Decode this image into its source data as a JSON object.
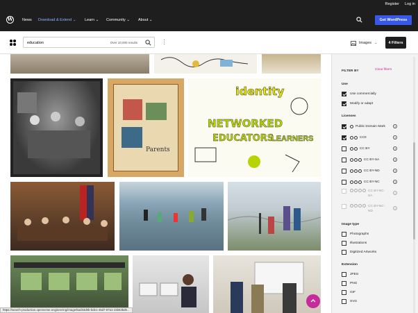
{
  "topbar": {
    "register": "Register",
    "login": "Log in"
  },
  "nav": {
    "items": [
      "News",
      "Download & Extend",
      "Learn",
      "Community",
      "About"
    ],
    "cta": "Get WordPress"
  },
  "search": {
    "query": "education",
    "count": "Over 10,000 results"
  },
  "media": {
    "type": "Images"
  },
  "filters": {
    "button": "4 Filters",
    "title": "FILTER BY",
    "clear": "Clear filters"
  },
  "sections": {
    "use": {
      "title": "Use",
      "items": [
        {
          "label": "Use commercially",
          "checked": true
        },
        {
          "label": "Modify or adapt",
          "checked": true
        }
      ]
    },
    "licenses": {
      "title": "Licenses",
      "items": [
        {
          "label": "Public Domain Mark",
          "checked": true
        },
        {
          "label": "CC0",
          "checked": true
        },
        {
          "label": "CC BY",
          "checked": false
        },
        {
          "label": "CC BY-SA",
          "checked": false
        },
        {
          "label": "CC BY-ND",
          "checked": false
        },
        {
          "label": "CC BY-NC",
          "checked": false
        },
        {
          "label": "CC BY-NC-SA",
          "checked": false
        },
        {
          "label": "CC BY-NC-ND",
          "checked": false
        }
      ]
    },
    "image_type": {
      "title": "Image type",
      "items": [
        "Photographs",
        "Illustrations",
        "Digitized Artworks"
      ]
    },
    "extension": {
      "title": "Extension",
      "items": [
        "JPEG",
        "PNG",
        "GIF",
        "SVG"
      ]
    }
  },
  "status_url": "https://search-production.openverse.engineering/image/5ad33d0b-bde1-45d7-87a1-15b63bd6...",
  "colors": {
    "dark": "#1e1e1e",
    "accent": "#3858e9",
    "pink": "#c52b9b"
  },
  "icons": [
    "wordpress-logo-icon",
    "search-icon",
    "openverse-logo-icon",
    "image-icon",
    "chevron-down-icon",
    "arrow-up-icon",
    "help-icon",
    "kebab-icon"
  ]
}
